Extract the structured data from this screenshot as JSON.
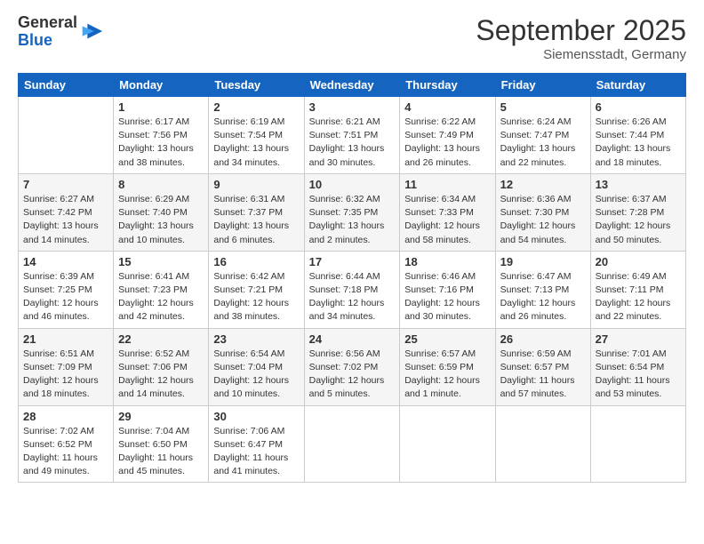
{
  "header": {
    "logo_general": "General",
    "logo_blue": "Blue",
    "month_title": "September 2025",
    "subtitle": "Siemensstadt, Germany"
  },
  "days_of_week": [
    "Sunday",
    "Monday",
    "Tuesday",
    "Wednesday",
    "Thursday",
    "Friday",
    "Saturday"
  ],
  "weeks": [
    [
      {
        "day": "",
        "info": ""
      },
      {
        "day": "1",
        "info": "Sunrise: 6:17 AM\nSunset: 7:56 PM\nDaylight: 13 hours\nand 38 minutes."
      },
      {
        "day": "2",
        "info": "Sunrise: 6:19 AM\nSunset: 7:54 PM\nDaylight: 13 hours\nand 34 minutes."
      },
      {
        "day": "3",
        "info": "Sunrise: 6:21 AM\nSunset: 7:51 PM\nDaylight: 13 hours\nand 30 minutes."
      },
      {
        "day": "4",
        "info": "Sunrise: 6:22 AM\nSunset: 7:49 PM\nDaylight: 13 hours\nand 26 minutes."
      },
      {
        "day": "5",
        "info": "Sunrise: 6:24 AM\nSunset: 7:47 PM\nDaylight: 13 hours\nand 22 minutes."
      },
      {
        "day": "6",
        "info": "Sunrise: 6:26 AM\nSunset: 7:44 PM\nDaylight: 13 hours\nand 18 minutes."
      }
    ],
    [
      {
        "day": "7",
        "info": "Sunrise: 6:27 AM\nSunset: 7:42 PM\nDaylight: 13 hours\nand 14 minutes."
      },
      {
        "day": "8",
        "info": "Sunrise: 6:29 AM\nSunset: 7:40 PM\nDaylight: 13 hours\nand 10 minutes."
      },
      {
        "day": "9",
        "info": "Sunrise: 6:31 AM\nSunset: 7:37 PM\nDaylight: 13 hours\nand 6 minutes."
      },
      {
        "day": "10",
        "info": "Sunrise: 6:32 AM\nSunset: 7:35 PM\nDaylight: 13 hours\nand 2 minutes."
      },
      {
        "day": "11",
        "info": "Sunrise: 6:34 AM\nSunset: 7:33 PM\nDaylight: 12 hours\nand 58 minutes."
      },
      {
        "day": "12",
        "info": "Sunrise: 6:36 AM\nSunset: 7:30 PM\nDaylight: 12 hours\nand 54 minutes."
      },
      {
        "day": "13",
        "info": "Sunrise: 6:37 AM\nSunset: 7:28 PM\nDaylight: 12 hours\nand 50 minutes."
      }
    ],
    [
      {
        "day": "14",
        "info": "Sunrise: 6:39 AM\nSunset: 7:25 PM\nDaylight: 12 hours\nand 46 minutes."
      },
      {
        "day": "15",
        "info": "Sunrise: 6:41 AM\nSunset: 7:23 PM\nDaylight: 12 hours\nand 42 minutes."
      },
      {
        "day": "16",
        "info": "Sunrise: 6:42 AM\nSunset: 7:21 PM\nDaylight: 12 hours\nand 38 minutes."
      },
      {
        "day": "17",
        "info": "Sunrise: 6:44 AM\nSunset: 7:18 PM\nDaylight: 12 hours\nand 34 minutes."
      },
      {
        "day": "18",
        "info": "Sunrise: 6:46 AM\nSunset: 7:16 PM\nDaylight: 12 hours\nand 30 minutes."
      },
      {
        "day": "19",
        "info": "Sunrise: 6:47 AM\nSunset: 7:13 PM\nDaylight: 12 hours\nand 26 minutes."
      },
      {
        "day": "20",
        "info": "Sunrise: 6:49 AM\nSunset: 7:11 PM\nDaylight: 12 hours\nand 22 minutes."
      }
    ],
    [
      {
        "day": "21",
        "info": "Sunrise: 6:51 AM\nSunset: 7:09 PM\nDaylight: 12 hours\nand 18 minutes."
      },
      {
        "day": "22",
        "info": "Sunrise: 6:52 AM\nSunset: 7:06 PM\nDaylight: 12 hours\nand 14 minutes."
      },
      {
        "day": "23",
        "info": "Sunrise: 6:54 AM\nSunset: 7:04 PM\nDaylight: 12 hours\nand 10 minutes."
      },
      {
        "day": "24",
        "info": "Sunrise: 6:56 AM\nSunset: 7:02 PM\nDaylight: 12 hours\nand 5 minutes."
      },
      {
        "day": "25",
        "info": "Sunrise: 6:57 AM\nSunset: 6:59 PM\nDaylight: 12 hours\nand 1 minute."
      },
      {
        "day": "26",
        "info": "Sunrise: 6:59 AM\nSunset: 6:57 PM\nDaylight: 11 hours\nand 57 minutes."
      },
      {
        "day": "27",
        "info": "Sunrise: 7:01 AM\nSunset: 6:54 PM\nDaylight: 11 hours\nand 53 minutes."
      }
    ],
    [
      {
        "day": "28",
        "info": "Sunrise: 7:02 AM\nSunset: 6:52 PM\nDaylight: 11 hours\nand 49 minutes."
      },
      {
        "day": "29",
        "info": "Sunrise: 7:04 AM\nSunset: 6:50 PM\nDaylight: 11 hours\nand 45 minutes."
      },
      {
        "day": "30",
        "info": "Sunrise: 7:06 AM\nSunset: 6:47 PM\nDaylight: 11 hours\nand 41 minutes."
      },
      {
        "day": "",
        "info": ""
      },
      {
        "day": "",
        "info": ""
      },
      {
        "day": "",
        "info": ""
      },
      {
        "day": "",
        "info": ""
      }
    ]
  ]
}
